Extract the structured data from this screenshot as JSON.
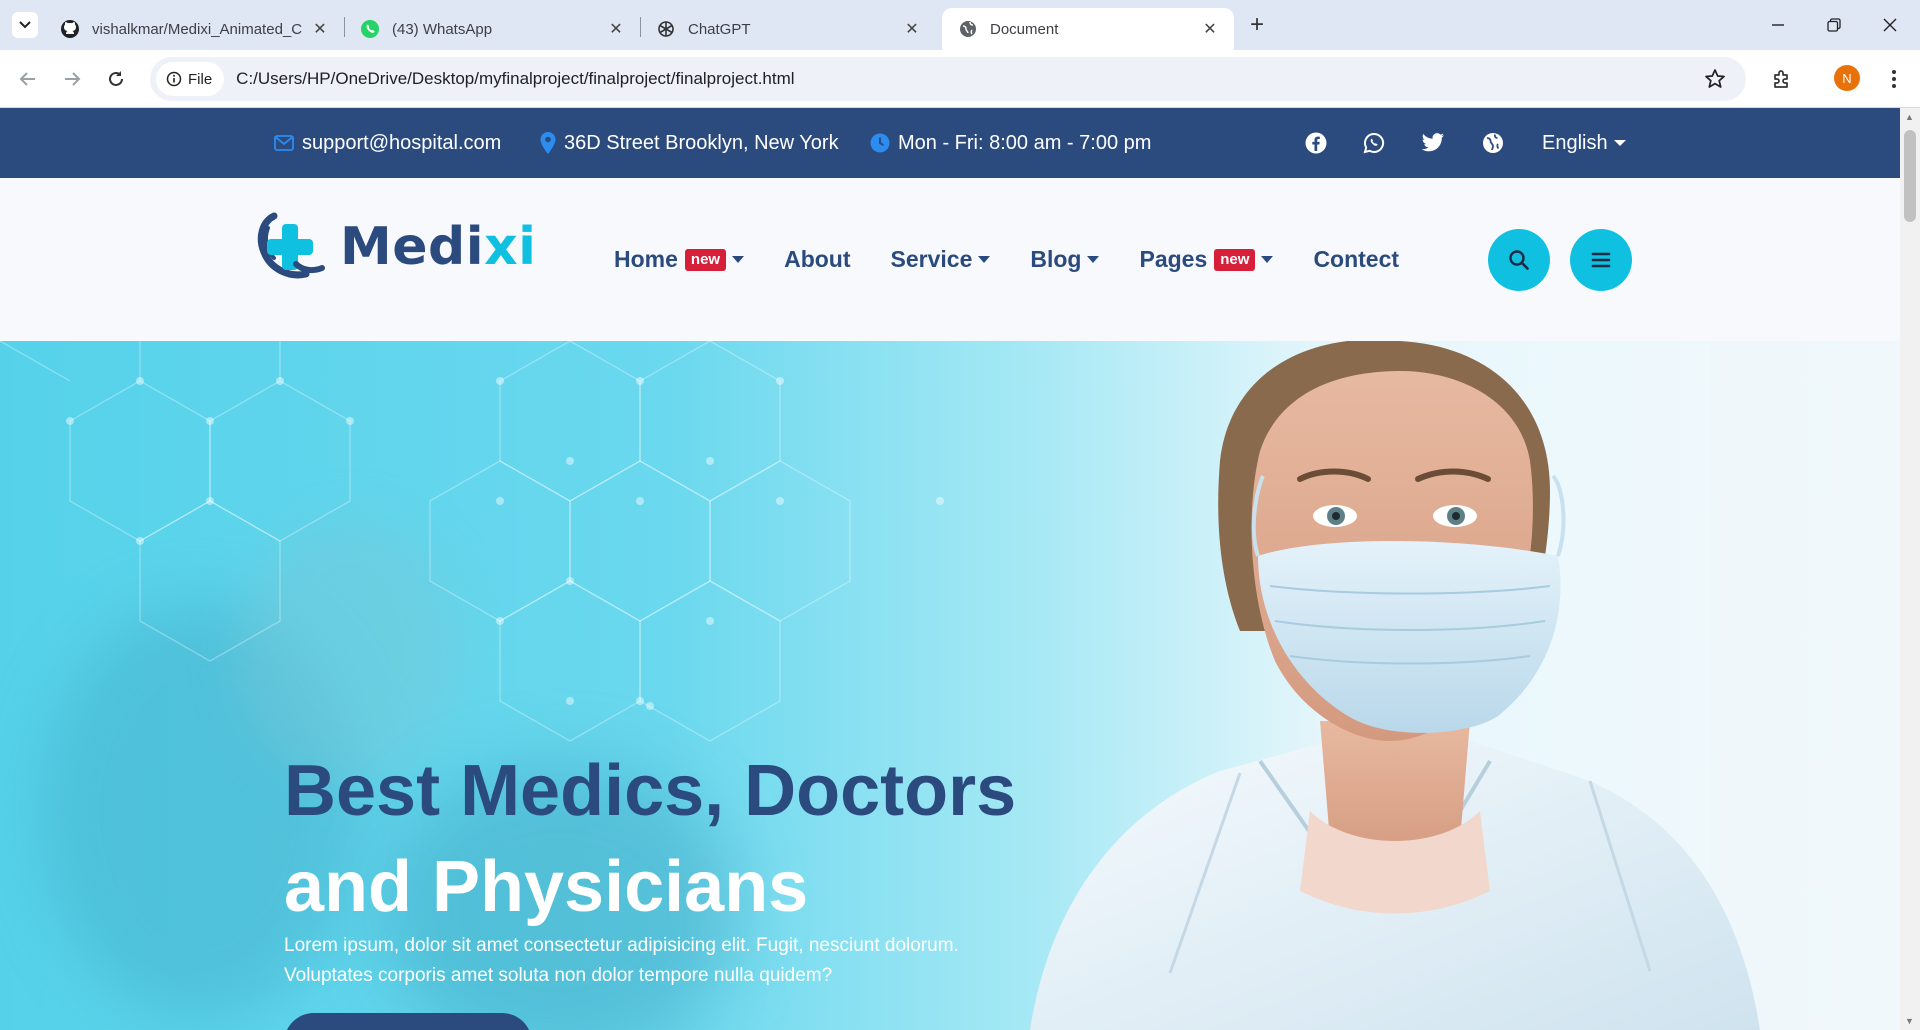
{
  "browser": {
    "tabs": [
      {
        "title": "vishalkmar/Medixi_Animated_C",
        "icon": "github-icon",
        "active": false
      },
      {
        "title": "(43) WhatsApp",
        "icon": "whatsapp-icon",
        "active": false
      },
      {
        "title": "ChatGPT",
        "icon": "chatgpt-icon",
        "active": false
      },
      {
        "title": "Document",
        "icon": "globe-icon",
        "active": true
      }
    ],
    "new_tab": "+",
    "url_chip": "File",
    "url": "C:/Users/HP/OneDrive/Desktop/myfinalproject/finalproject/finalproject.html",
    "profile_initial": "N",
    "profile_color": "#e8710a"
  },
  "topbar": {
    "email": "support@hospital.com",
    "address": "36D Street Brooklyn, New York",
    "hours": "Mon - Fri: 8:00 am - 7:00 pm",
    "social": [
      "facebook-icon",
      "whatsapp-icon",
      "twitter-icon",
      "globe-icon"
    ],
    "language": "English",
    "background": "#2b4a7e"
  },
  "header": {
    "logo": {
      "text_main": "Medi",
      "text_accent": "xi"
    },
    "menu": [
      {
        "label": "Home",
        "badge": "new",
        "dropdown": true
      },
      {
        "label": "About",
        "badge": "",
        "dropdown": false
      },
      {
        "label": "Service",
        "badge": "",
        "dropdown": true
      },
      {
        "label": "Blog",
        "badge": "",
        "dropdown": true
      },
      {
        "label": "Pages",
        "badge": "new",
        "dropdown": true
      },
      {
        "label": "Contect",
        "badge": "",
        "dropdown": false
      }
    ],
    "accent": "#10c0e0",
    "badge_color": "#d6203a"
  },
  "hero": {
    "title_line1": "Best Medics, Doctors",
    "title_line2": "and Physicians",
    "text": "Lorem ipsum, dolor sit amet consectetur adipisicing elit. Fugit, nesciunt dolorum. Voluptates corporis amet soluta non dolor tempore nulla quidem?"
  }
}
